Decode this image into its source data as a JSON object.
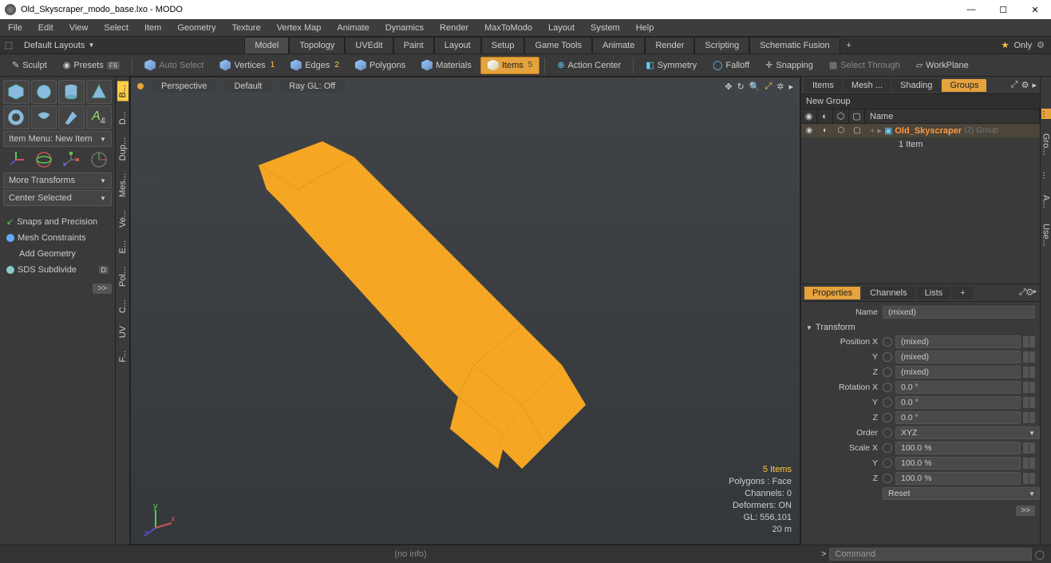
{
  "title": "Old_Skyscraper_modo_base.lxo - MODO",
  "menu": [
    "File",
    "Edit",
    "View",
    "Select",
    "Item",
    "Geometry",
    "Texture",
    "Vertex Map",
    "Animate",
    "Dynamics",
    "Render",
    "MaxToModo",
    "Layout",
    "System",
    "Help"
  ],
  "layoutSelector": "Default Layouts",
  "layoutTabs": [
    "Model",
    "Topology",
    "UVEdit",
    "Paint",
    "Layout",
    "Setup",
    "Game Tools",
    "Animate",
    "Render",
    "Scripting",
    "Schematic Fusion"
  ],
  "layoutActive": "Model",
  "onlyLabel": "Only",
  "toolbar": {
    "sculpt": "Sculpt",
    "presets": "Presets",
    "presetsKey": "F6",
    "autoSelect": "Auto Select",
    "vertices": "Vertices",
    "verticesNum": "1",
    "edges": "Edges",
    "edgesNum": "2",
    "polygons": "Polygons",
    "materials": "Materials",
    "items": "Items",
    "itemsNum": "5",
    "actionCenter": "Action Center",
    "symmetry": "Symmetry",
    "falloff": "Falloff",
    "snapping": "Snapping",
    "selectThrough": "Select Through",
    "workPlane": "WorkPlane"
  },
  "leftPanel": {
    "itemMenu": "Item Menu: New Item",
    "moreTransforms": "More Transforms",
    "centerSelected": "Center Selected",
    "snaps": "Snaps and Precision",
    "meshConstraints": "Mesh Constraints",
    "addGeometry": "Add Geometry",
    "sdsSubdivide": "SDS Subdivide",
    "sdsKey": "D",
    "arrow": ">>"
  },
  "vstrip": [
    "B...",
    "D...",
    "Dup...",
    "Mes...",
    "Ve...",
    "E...",
    "Pol...",
    "C...",
    "UV",
    "F..."
  ],
  "viewport": {
    "persp": "Perspective",
    "default": "Default",
    "rayGL": "Ray GL: Off",
    "stats": {
      "items": "5 Items",
      "polygons": "Polygons : Face",
      "channels": "Channels: 0",
      "deformers": "Deformers: ON",
      "gl": "GL: 556,101",
      "dist": "20 m"
    }
  },
  "right": {
    "tabs": [
      "Items",
      "Mesh ...",
      "Shading",
      "Groups"
    ],
    "activeTab": "Groups",
    "newGroup": "New Group",
    "nameHeader": "Name",
    "groupName": "Old_Skyscraper",
    "groupMeta": "(2)  Group",
    "itemCount": "1 Item"
  },
  "props": {
    "tabs": [
      "Properties",
      "Channels",
      "Lists",
      "+"
    ],
    "activeTab": "Properties",
    "nameLbl": "Name",
    "nameVal": "(mixed)",
    "transform": "Transform",
    "posLbl": "Position X",
    "posX": "(mixed)",
    "posY": "(mixed)",
    "posZ": "(mixed)",
    "rotLbl": "Rotation X",
    "rotX": "0.0 °",
    "rotY": "0.0 °",
    "rotZ": "0.0 °",
    "orderLbl": "Order",
    "orderVal": "XYZ",
    "scaleLbl": "Scale X",
    "scaleX": "100.0 %",
    "scaleY": "100.0 %",
    "scaleZ": "100.0 %",
    "reset": "Reset",
    "arrow": ">>",
    "y": "Y",
    "z": "Z"
  },
  "vstrip2": [
    "...",
    "Gro...",
    "...",
    "A...",
    "Use..."
  ],
  "bottom": {
    "info": "(no info)",
    "cmdPlaceholder": "Command",
    "chev": ">"
  }
}
